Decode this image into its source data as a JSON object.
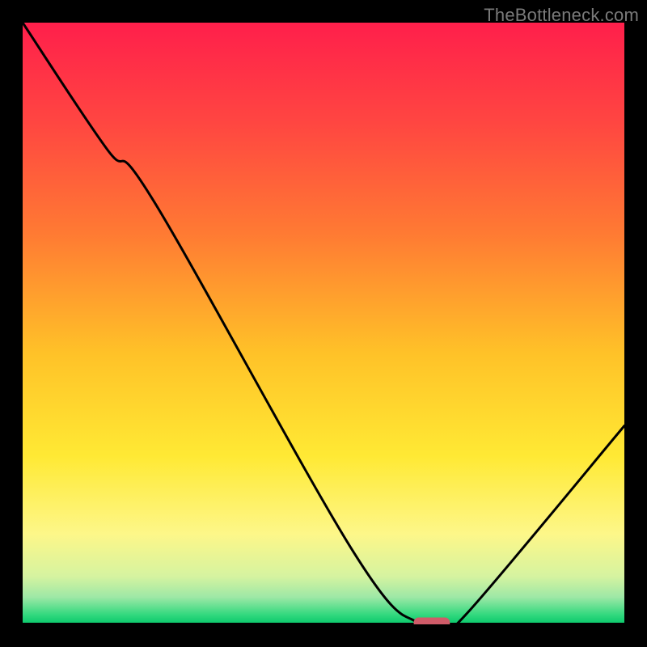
{
  "watermark": "TheBottleneck.com",
  "chart_data": {
    "type": "line",
    "title": "",
    "xlabel": "",
    "ylabel": "",
    "xlim": [
      0,
      100
    ],
    "ylim": [
      0,
      100
    ],
    "grid": false,
    "series": [
      {
        "name": "bottleneck-curve",
        "x": [
          0,
          14,
          22,
          55,
          66,
          70,
          74,
          100
        ],
        "values": [
          100,
          79,
          70,
          12,
          0,
          0,
          2,
          33
        ]
      }
    ],
    "marker": {
      "name": "optimal-marker",
      "x": 68,
      "y": 0,
      "color": "#cf5b68",
      "width_pct": 6.0,
      "height_pct": 2.0
    },
    "gradient_stops": [
      {
        "offset": 0.0,
        "color": "#ff1f4b"
      },
      {
        "offset": 0.17,
        "color": "#ff4741"
      },
      {
        "offset": 0.35,
        "color": "#ff7a33"
      },
      {
        "offset": 0.55,
        "color": "#ffc228"
      },
      {
        "offset": 0.72,
        "color": "#ffe934"
      },
      {
        "offset": 0.85,
        "color": "#fdf789"
      },
      {
        "offset": 0.92,
        "color": "#d6f3a0"
      },
      {
        "offset": 0.955,
        "color": "#9de8a6"
      },
      {
        "offset": 0.985,
        "color": "#2fd87d"
      },
      {
        "offset": 1.0,
        "color": "#07c66a"
      }
    ]
  }
}
